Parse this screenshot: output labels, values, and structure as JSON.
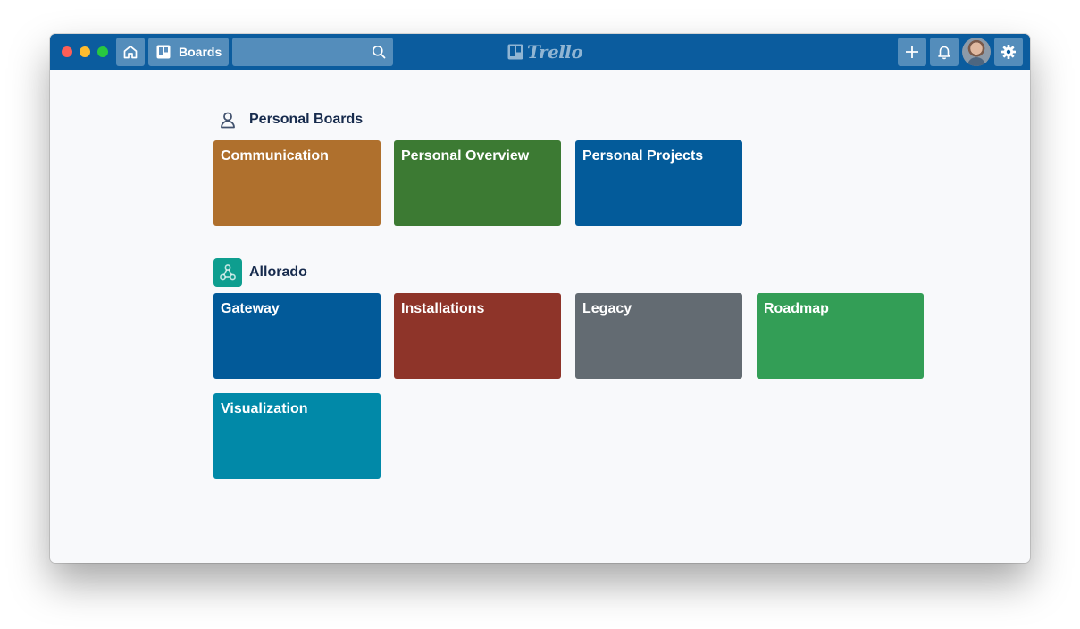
{
  "header": {
    "boards_label": "Boards",
    "search": {
      "value": "",
      "placeholder": ""
    },
    "logo_text": "Trello"
  },
  "sections": [
    {
      "title": "Personal Boards",
      "icon": "person-icon",
      "boards": [
        {
          "name": "Communication",
          "color": "#af702d"
        },
        {
          "name": "Personal Overview",
          "color": "#3c7a33"
        },
        {
          "name": "Personal Projects",
          "color": "#035b9a"
        }
      ]
    },
    {
      "title": "Allorado",
      "icon": "team-icon",
      "boards": [
        {
          "name": "Gateway",
          "color": "#025a99"
        },
        {
          "name": "Installations",
          "color": "#8e3429"
        },
        {
          "name": "Legacy",
          "color": "#636b72"
        },
        {
          "name": "Roadmap",
          "color": "#339e56"
        },
        {
          "name": "Visualization",
          "color": "#0189a8"
        }
      ]
    }
  ],
  "colors": {
    "topbar": "#0b5c9e",
    "background": "#f8f9fb",
    "team_icon": "#0e9e8f"
  }
}
